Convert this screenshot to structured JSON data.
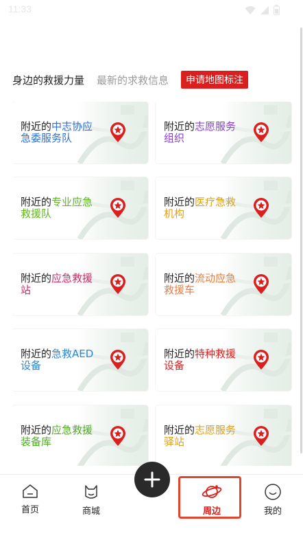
{
  "status_bar": {
    "time": "11:33"
  },
  "tabs": [
    {
      "label": "身边的救援力量",
      "active": true
    },
    {
      "label": "最新的求救信息",
      "active": false
    }
  ],
  "apply_button": {
    "label": "申请地图标注",
    "color": "#d9201f"
  },
  "cards": [
    {
      "prefix": "附近的",
      "highlight": "中志协应急委服务队",
      "color": "#2f6fd6",
      "icon": "location-pin-star-icon"
    },
    {
      "prefix": "附近的",
      "highlight": "志愿服务组织",
      "color": "#8a3fd1",
      "icon": "location-pin-star-icon"
    },
    {
      "prefix": "附近的",
      "highlight": "专业应急救援队",
      "color": "#5fb81d",
      "icon": "location-pin-star-icon"
    },
    {
      "prefix": "附近的",
      "highlight": "医疗急救机构",
      "color": "#e0a015",
      "icon": "location-pin-star-icon"
    },
    {
      "prefix": "附近的",
      "highlight": "应急救援站",
      "color": "#d12a6c",
      "icon": "location-pin-star-icon"
    },
    {
      "prefix": "附近的",
      "highlight": "流动应急救援车",
      "color": "#ef7b3a",
      "icon": "location-pin-star-icon"
    },
    {
      "prefix": "附近的",
      "highlight": "急救AED设备",
      "color": "#2a86d6",
      "icon": "location-pin-star-icon"
    },
    {
      "prefix": "附近的",
      "highlight": "特种救援设备",
      "color": "#d92525",
      "icon": "location-pin-star-icon"
    },
    {
      "prefix": "附近的",
      "highlight": "应急救援装备库",
      "color": "#4caf1f",
      "icon": "location-pin-star-icon"
    },
    {
      "prefix": "附近的",
      "highlight": "志愿服务驿站",
      "color": "#e0a015",
      "icon": "location-pin-star-icon"
    }
  ],
  "bottom_nav": [
    {
      "label": "首页",
      "icon": "home-icon",
      "active": false
    },
    {
      "label": "商城",
      "icon": "shop-cat-icon",
      "active": false
    },
    {
      "label": "周边",
      "icon": "planet-icon",
      "active": true
    },
    {
      "label": "我的",
      "icon": "smiley-face-icon",
      "active": false
    }
  ],
  "fab": {
    "icon": "plus-icon"
  },
  "colors": {
    "accent": "#d9201f",
    "pin": "#d9201f"
  }
}
